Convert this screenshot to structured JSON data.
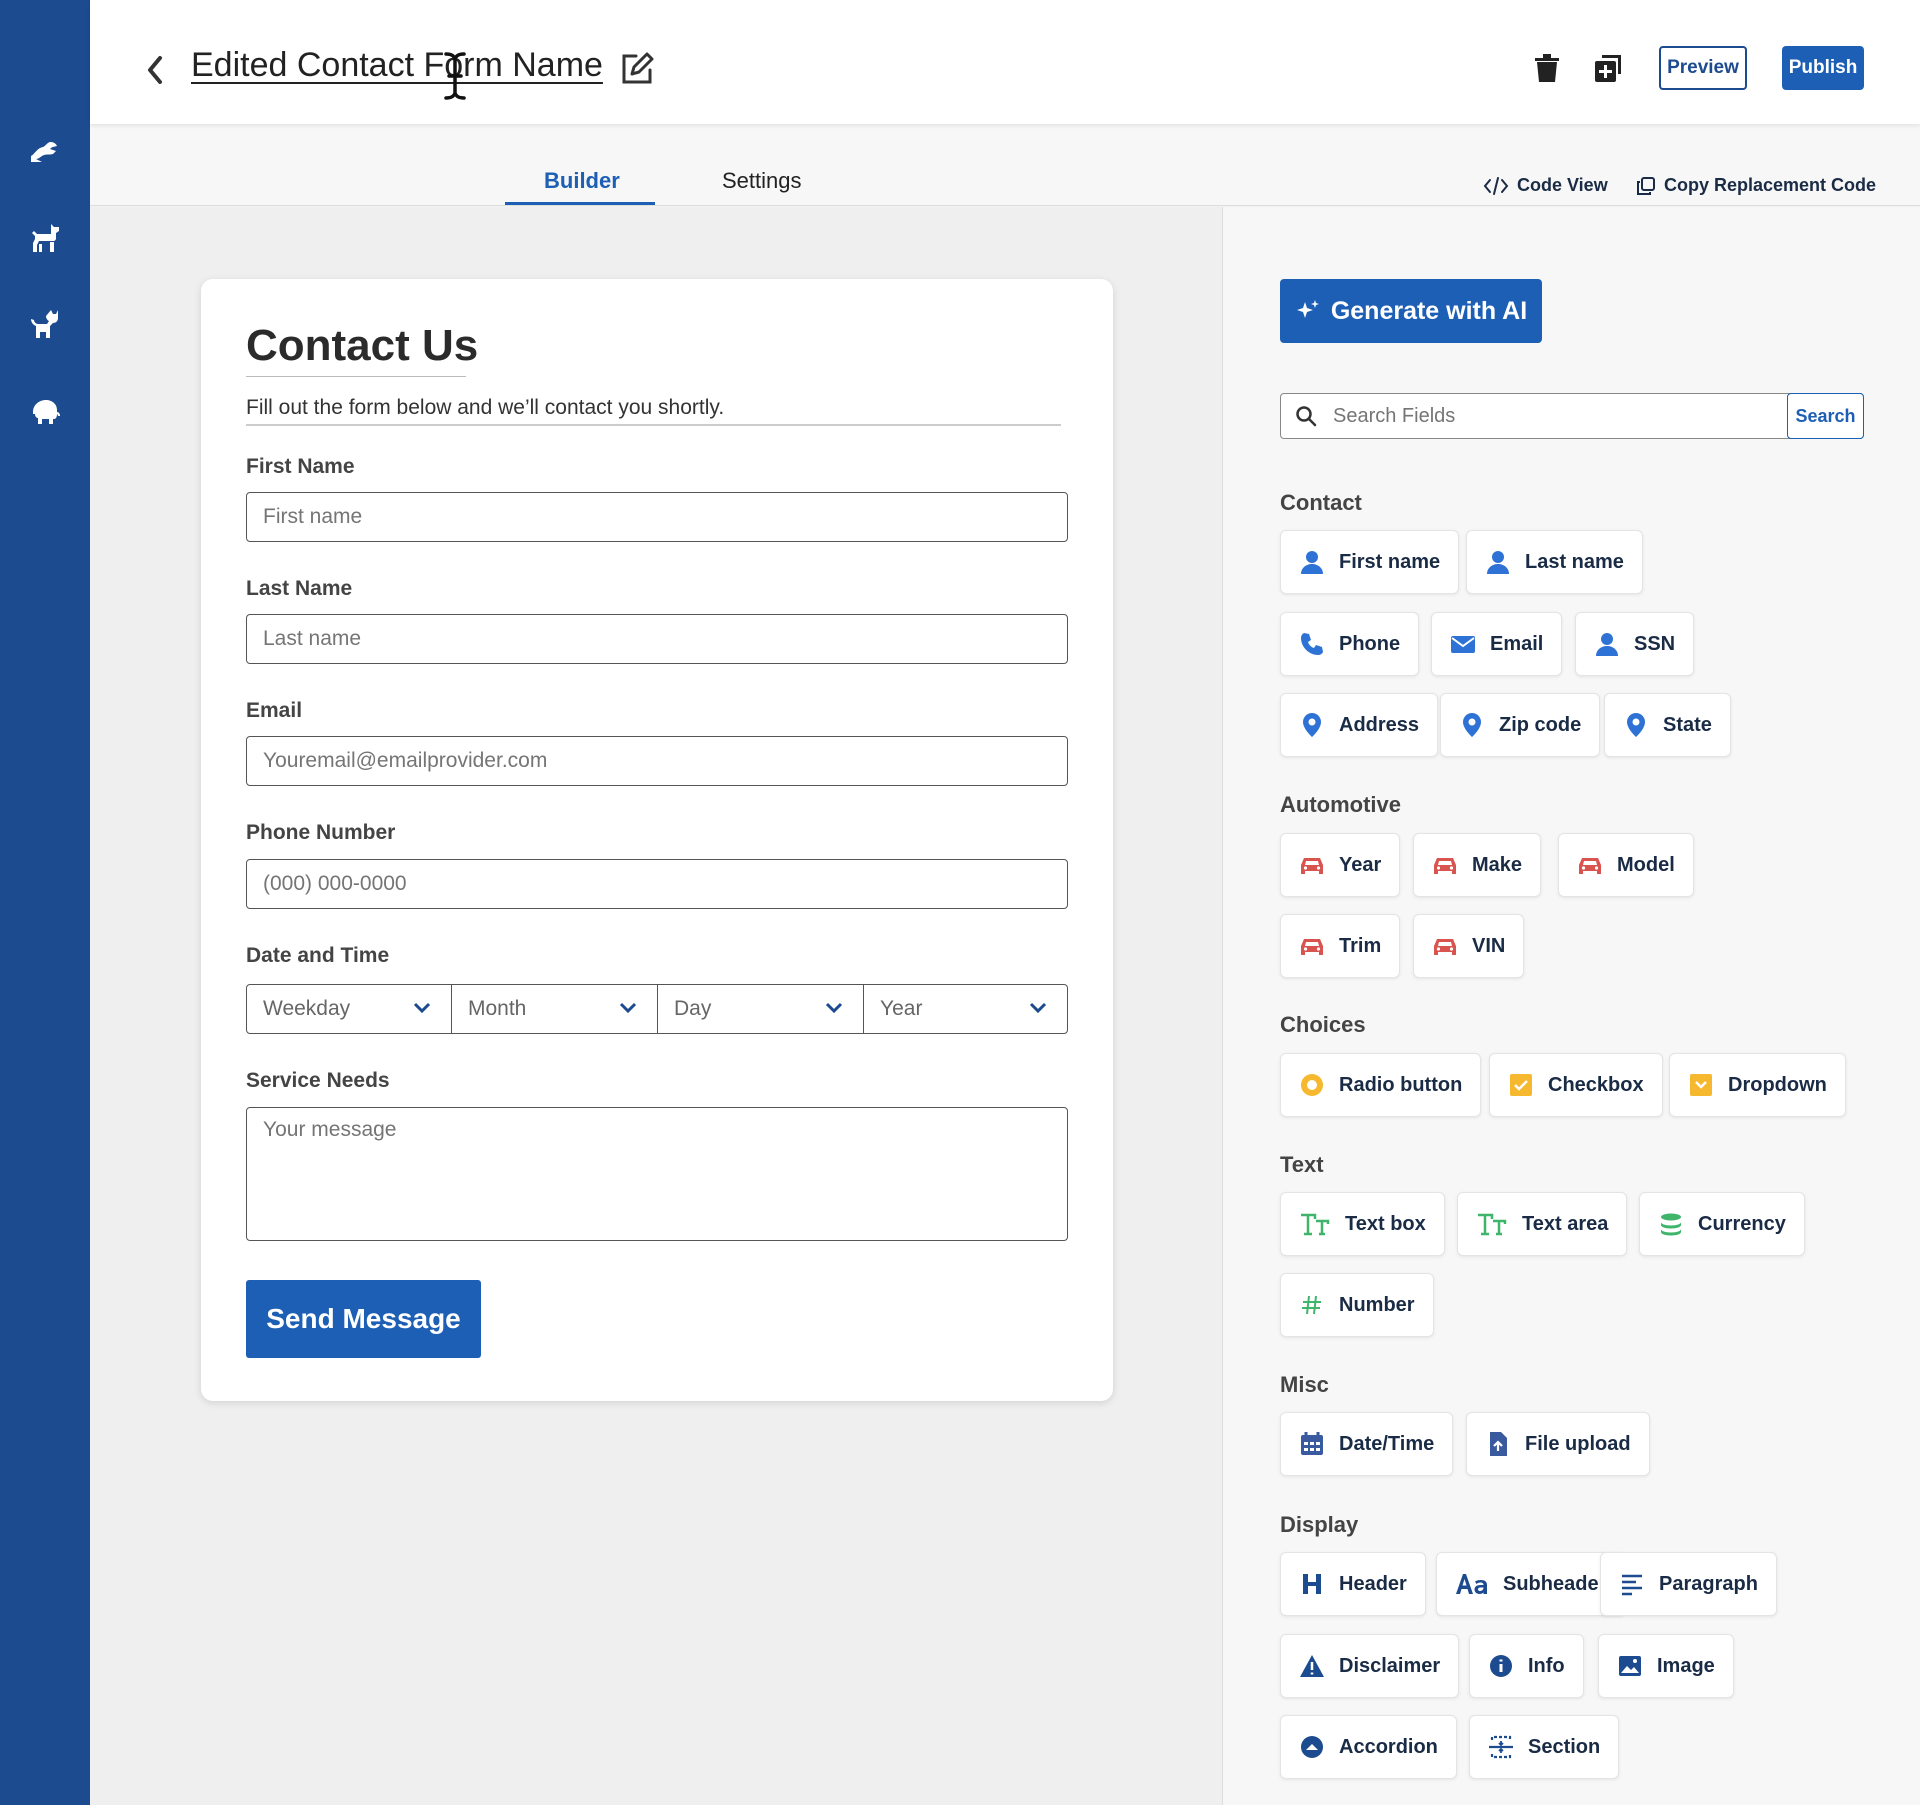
{
  "header": {
    "form_title": "Edited Contact Form Name",
    "preview_label": "Preview",
    "publish_label": "Publish"
  },
  "tabs": {
    "builder": "Builder",
    "settings": "Settings",
    "code_view": "Code View",
    "copy_code": "Copy Replacement Code"
  },
  "form": {
    "title": "Contact Us",
    "subtitle": "Fill out the form below and we’ll contact you shortly.",
    "fields": {
      "first_name": {
        "label": "First Name",
        "placeholder": "First name"
      },
      "last_name": {
        "label": "Last Name",
        "placeholder": "Last name"
      },
      "email": {
        "label": "Email",
        "placeholder": "Youremail@emailprovider.com"
      },
      "phone": {
        "label": "Phone Number",
        "placeholder": "(000) 000-0000"
      },
      "datetime": {
        "label": "Date and Time",
        "weekday": "Weekday",
        "month": "Month",
        "day": "Day",
        "year": "Year"
      },
      "service": {
        "label": "Service Needs",
        "placeholder": "Your message"
      }
    },
    "submit_label": "Send Message"
  },
  "panel": {
    "ai_label": "Generate with AI",
    "search_placeholder": "Search Fields",
    "search_button": "Search",
    "sections": {
      "contact": "Contact",
      "automotive": "Automotive",
      "choices": "Choices",
      "text": "Text",
      "misc": "Misc",
      "display": "Display"
    },
    "chips": {
      "first_name": "First name",
      "last_name": "Last name",
      "phone": "Phone",
      "email": "Email",
      "ssn": "SSN",
      "address": "Address",
      "zip": "Zip code",
      "state": "State",
      "year": "Year",
      "make": "Make",
      "model": "Model",
      "trim": "Trim",
      "vin": "VIN",
      "radio": "Radio button",
      "checkbox": "Checkbox",
      "dropdown": "Dropdown",
      "text_box": "Text box",
      "text_area": "Text area",
      "currency": "Currency",
      "number": "Number",
      "datetime": "Date/Time",
      "file_upload": "File upload",
      "header": "Header",
      "subheader": "Subheader",
      "paragraph": "Paragraph",
      "disclaimer": "Disclaimer",
      "info": "Info",
      "image": "Image",
      "accordion": "Accordion",
      "section": "Section"
    }
  },
  "colors": {
    "rail": "#1d4b8f",
    "primary": "#1d5fb4",
    "contact_icon": "#2f72d6",
    "auto_icon": "#d9534f",
    "choice_icon": "#f5b82e",
    "text_icon": "#3fb56b",
    "display_icon": "#1d4b8f"
  }
}
